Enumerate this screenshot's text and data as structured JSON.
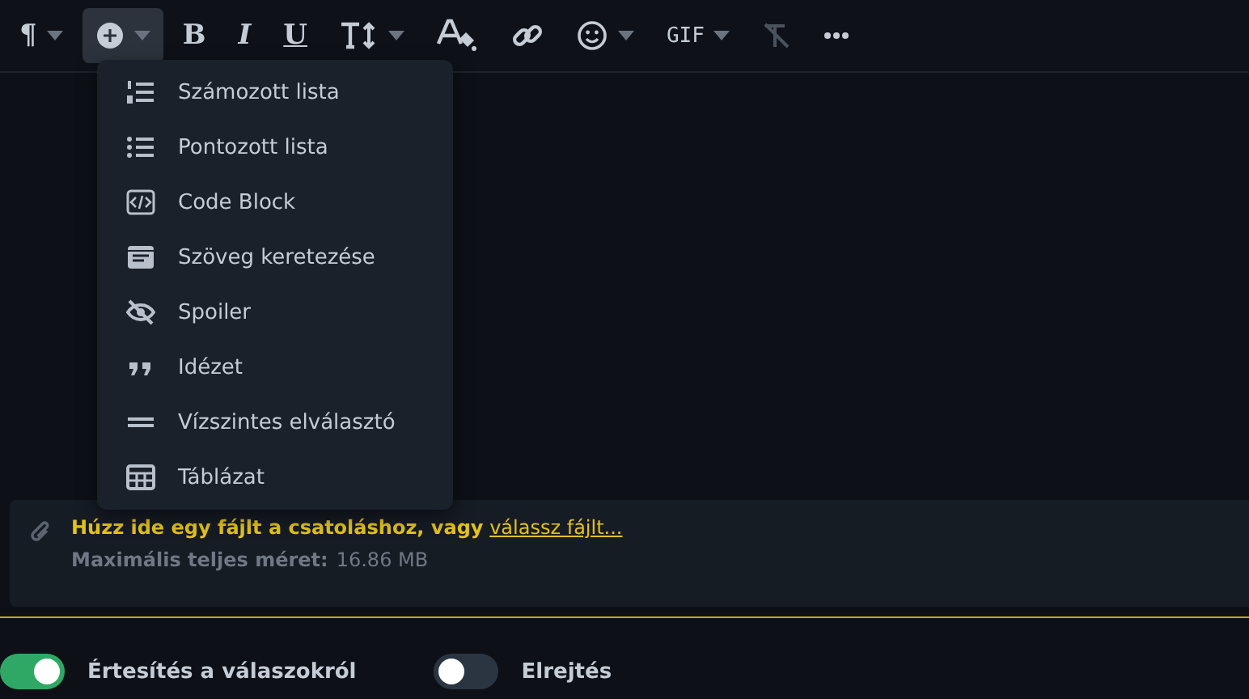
{
  "toolbar": [
    {
      "kind": "paragraph",
      "label": "¶",
      "dropdown": true,
      "selected": false,
      "disabled": false
    },
    {
      "kind": "insert",
      "dropdown": true,
      "selected": true,
      "disabled": false
    },
    {
      "kind": "bold",
      "label": "B",
      "dropdown": false,
      "selected": false,
      "disabled": false
    },
    {
      "kind": "italic",
      "label": "I",
      "dropdown": false,
      "selected": false,
      "disabled": false
    },
    {
      "kind": "underline",
      "label": "U",
      "dropdown": false,
      "selected": false,
      "disabled": false
    },
    {
      "kind": "textsize",
      "dropdown": true,
      "selected": false,
      "disabled": false
    },
    {
      "kind": "color",
      "dropdown": false,
      "selected": false,
      "disabled": false
    },
    {
      "kind": "link",
      "dropdown": false,
      "selected": false,
      "disabled": false
    },
    {
      "kind": "emoji",
      "dropdown": true,
      "selected": false,
      "disabled": false
    },
    {
      "kind": "gif",
      "label": "GIF",
      "dropdown": true,
      "selected": false,
      "disabled": false
    },
    {
      "kind": "clear",
      "dropdown": false,
      "selected": false,
      "disabled": true
    },
    {
      "kind": "more",
      "dropdown": false,
      "selected": false,
      "disabled": false
    }
  ],
  "insert_menu": [
    {
      "kind": "numbered",
      "label": "Számozott lista"
    },
    {
      "kind": "bulleted",
      "label": "Pontozott lista"
    },
    {
      "kind": "code",
      "label": "Code Block"
    },
    {
      "kind": "frame",
      "label": "Szöveg keretezése"
    },
    {
      "kind": "spoiler",
      "label": "Spoiler"
    },
    {
      "kind": "quote",
      "label": "Idézet"
    },
    {
      "kind": "rule",
      "label": "Vízszintes elválasztó"
    },
    {
      "kind": "table",
      "label": "Táblázat"
    }
  ],
  "attachment": {
    "prompt": "Húzz ide egy fájlt a csatoláshoz, vagy",
    "link": "válassz fájlt...",
    "size_label": "Maximális teljes méret:",
    "size_value": "16.86 MB"
  },
  "toggles": [
    {
      "label": "Értesítés a válaszokról",
      "on": true
    },
    {
      "label": "Elrejtés",
      "on": false
    }
  ]
}
